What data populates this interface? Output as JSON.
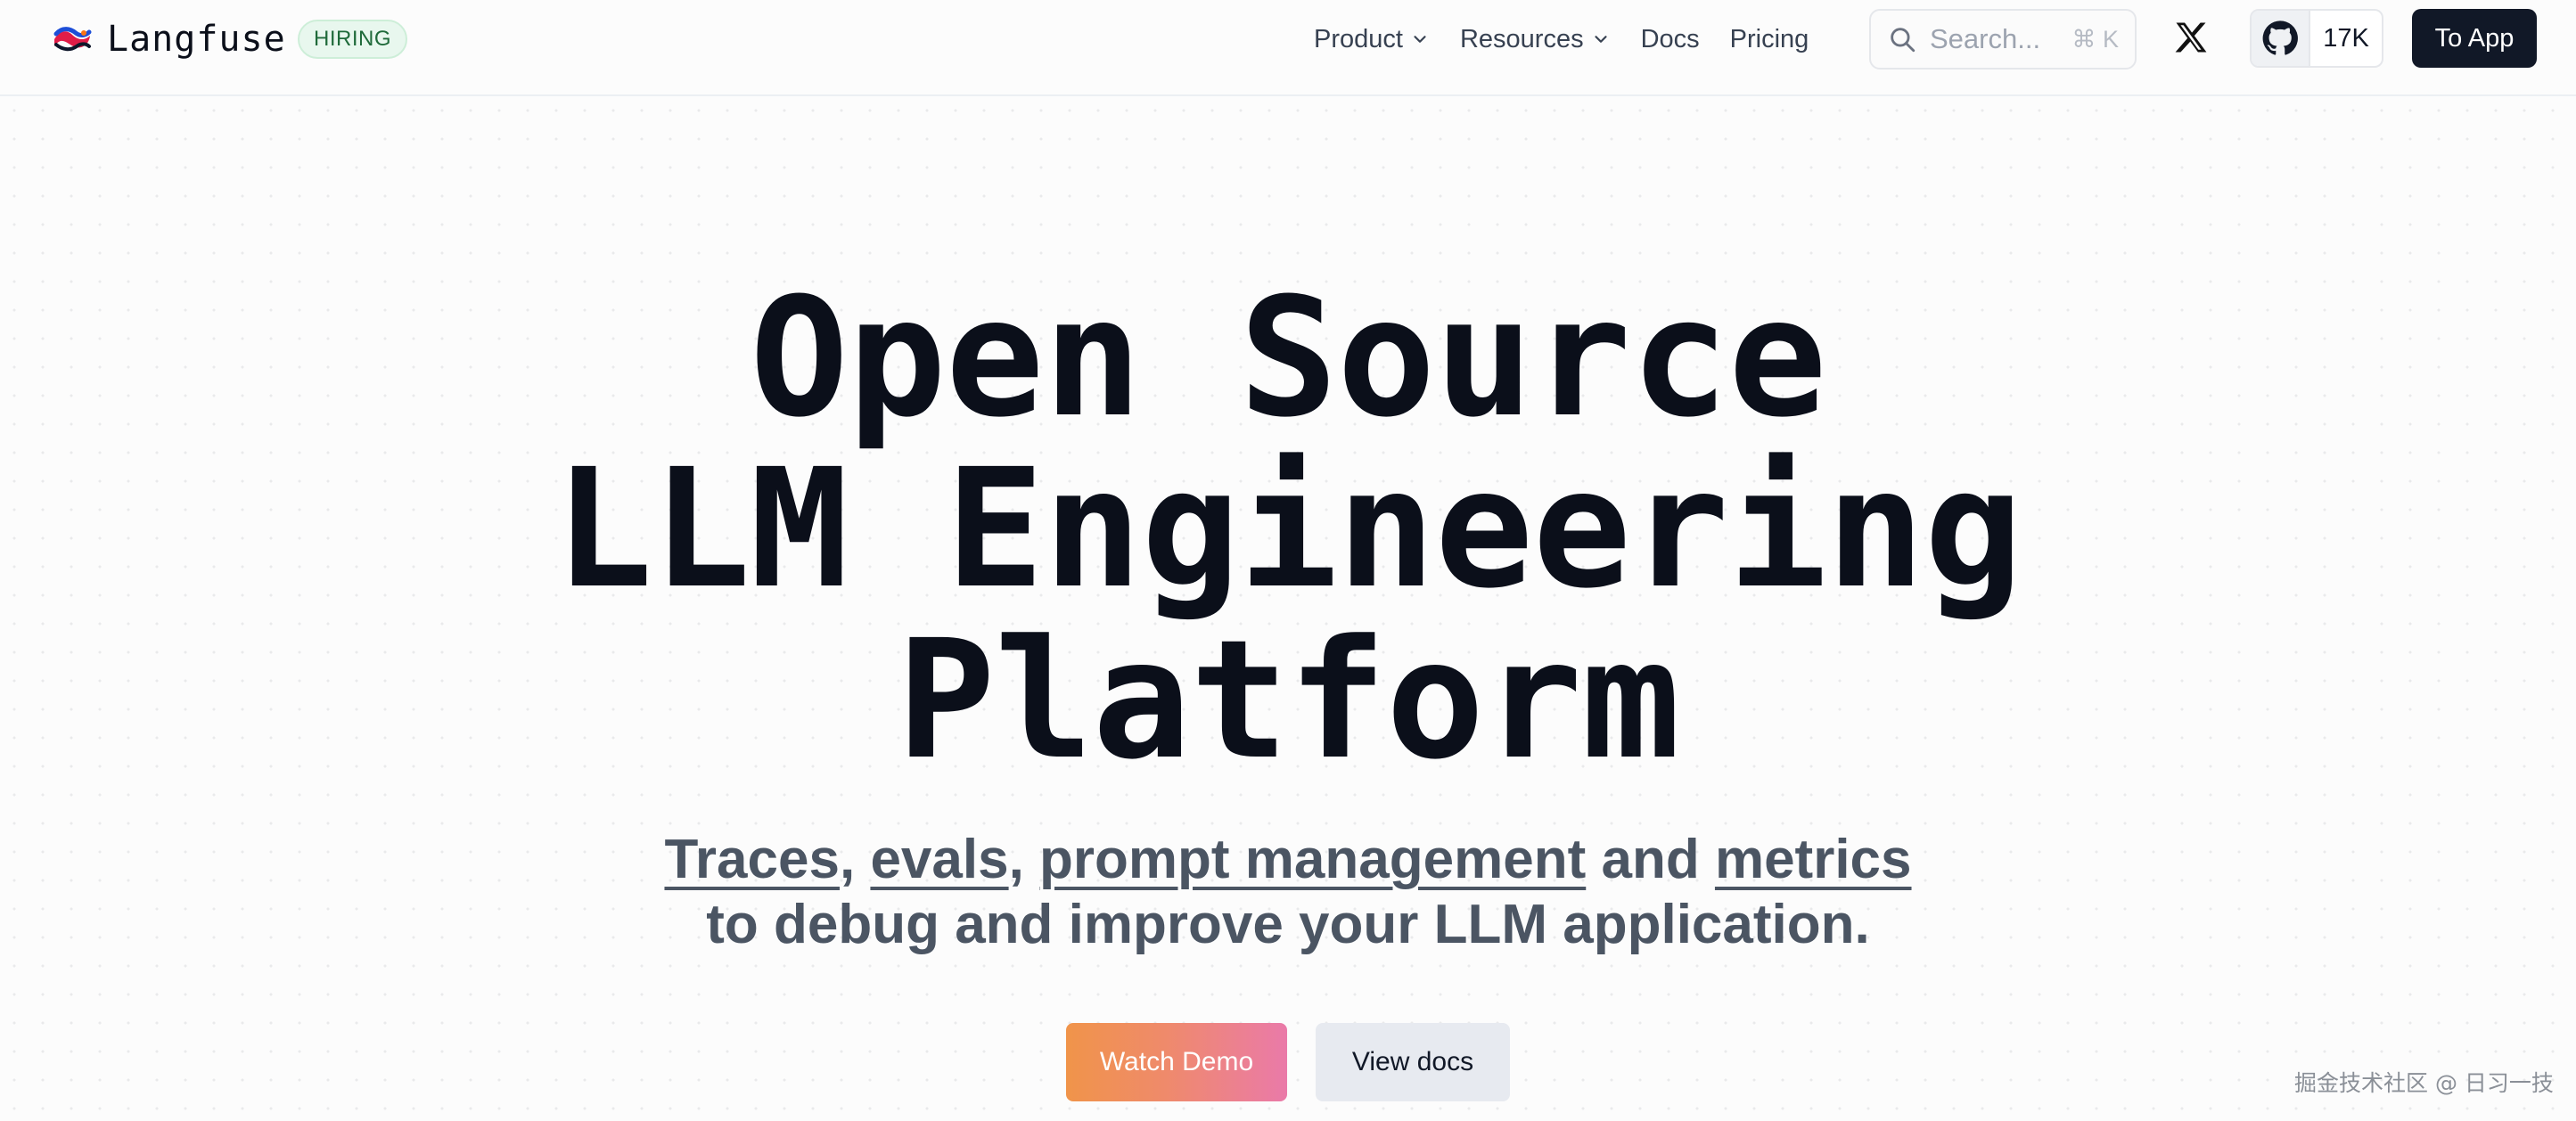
{
  "brand": {
    "name": "Langfuse",
    "logo_icon": "langfuse-logo-icon",
    "hiring_badge": "HIRING"
  },
  "nav": {
    "items": [
      {
        "label": "Product",
        "has_dropdown": true
      },
      {
        "label": "Resources",
        "has_dropdown": true
      },
      {
        "label": "Docs",
        "has_dropdown": false
      },
      {
        "label": "Pricing",
        "has_dropdown": false
      }
    ]
  },
  "search": {
    "placeholder": "Search...",
    "shortcut": "⌘ K"
  },
  "social": {
    "x_icon": "x-icon",
    "github_icon": "github-icon",
    "github_stars": "17K"
  },
  "header": {
    "cta_label": "To App"
  },
  "hero": {
    "title_lines": [
      "Open Source",
      "LLM Engineering",
      "Platform"
    ],
    "subtitle": {
      "link_traces": "Traces",
      "sep_comma_1": ", ",
      "link_evals": "evals",
      "sep_comma_2": ", ",
      "link_prompt_management": "prompt management",
      "sep_and": " and ",
      "link_metrics": "metrics",
      "line2": "to debug and improve your LLM application."
    },
    "buttons": {
      "watch_demo": "Watch Demo",
      "view_docs": "View docs"
    }
  },
  "watermark": "掘金技术社区 @ 日习一技",
  "colors": {
    "text_primary": "#0b0f1a",
    "text_muted": "#4b5563",
    "hiring_bg": "#e8f7ee",
    "hiring_text": "#1f6a3a",
    "cta_dark": "#111827",
    "demo_gradient_start": "#f0944a",
    "demo_gradient_end": "#ea7aa9",
    "docs_button": "#e7eaf0"
  }
}
